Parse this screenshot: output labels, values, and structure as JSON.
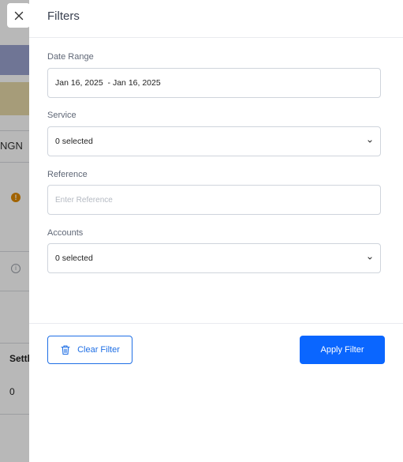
{
  "background": {
    "currency_fragment": "NGN",
    "column_fragment": "Settl",
    "value_fragment": "0"
  },
  "drawer": {
    "title": "Filters",
    "fields": {
      "date_range": {
        "label": "Date Range",
        "value": "Jan 16, 2025  - Jan 16, 2025"
      },
      "service": {
        "label": "Service",
        "value": "0 selected"
      },
      "reference": {
        "label": "Reference",
        "placeholder": "Enter Reference"
      },
      "accounts": {
        "label": "Accounts",
        "value": "0 selected"
      }
    },
    "buttons": {
      "clear": "Clear Filter",
      "apply": "Apply Filter"
    }
  },
  "colors": {
    "accent": "#0a66ff",
    "warning": "#e08a00"
  },
  "icons": {
    "close": "close-icon",
    "chevron": "chevron-down-icon",
    "trash": "trash-icon"
  }
}
